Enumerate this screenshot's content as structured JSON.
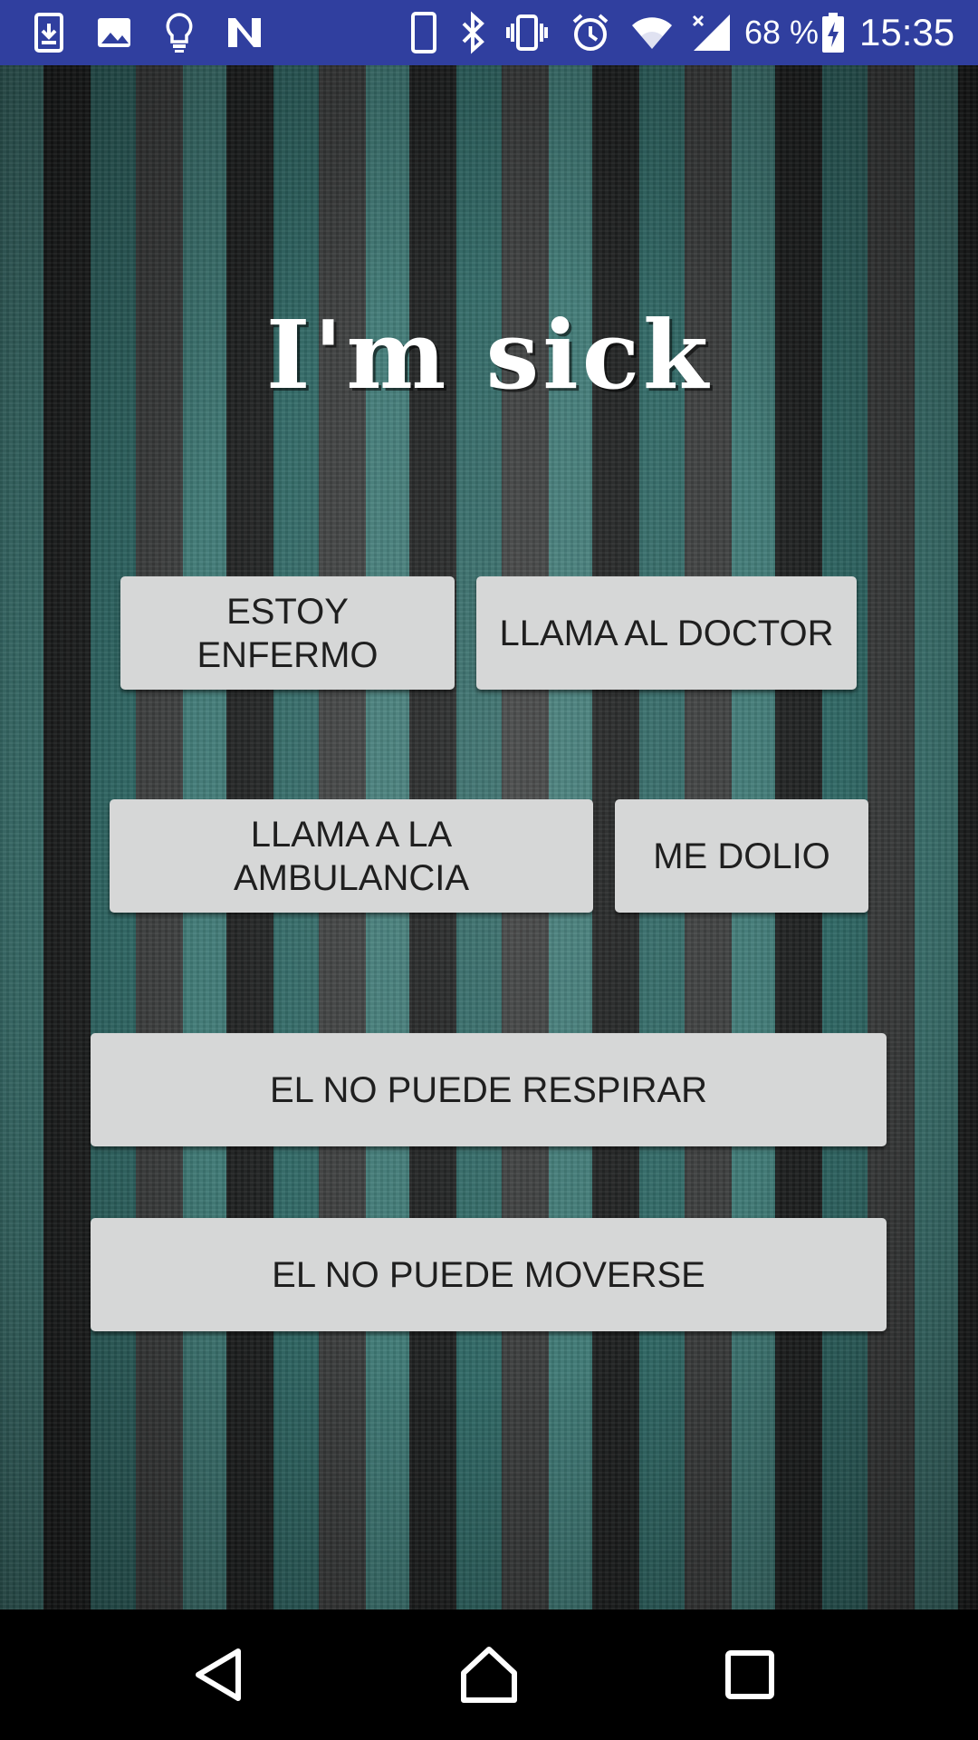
{
  "status_bar": {
    "battery": "68 %",
    "time": "15:35",
    "icons": [
      "download-icon",
      "image-icon",
      "lightbulb-icon",
      "n-app-icon",
      "phone-icon",
      "bluetooth-icon",
      "vibrate-icon",
      "alarm-icon",
      "wifi-icon",
      "signal-icon",
      "battery-charging-icon"
    ],
    "background_color": "#303f9f"
  },
  "main": {
    "title": "I'm sick",
    "buttons": [
      {
        "label_line1": "ESTOY",
        "label_line2": "ENFERMO"
      },
      {
        "label": "LLAMA AL DOCTOR"
      },
      {
        "label_line1": "LLAMA A LA",
        "label_line2": "AMBULANCIA"
      },
      {
        "label": "ME DOLIO"
      },
      {
        "label": "EL NO PUEDE RESPIRAR"
      },
      {
        "label": "EL NO PUEDE MOVERSE"
      }
    ]
  },
  "nav_bar": {
    "icons": [
      "back-icon",
      "home-icon",
      "recents-icon"
    ]
  }
}
